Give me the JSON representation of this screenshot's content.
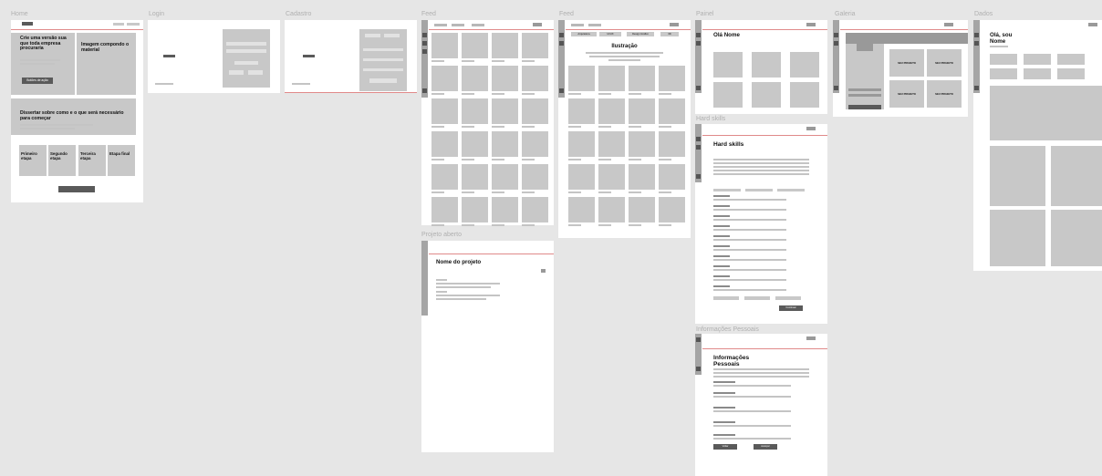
{
  "frames": {
    "home": "Home",
    "login": "Login",
    "cadastro": "Cadastro",
    "feed1": "Feed",
    "feed2": "Feed",
    "painel": "Painel",
    "galeria": "Galeria",
    "dados": "Dados",
    "projeto": "Projeto aberto",
    "hard": "Hard skills",
    "info": "Informações Pessoais"
  },
  "home": {
    "hero_title": "Crie uma versão sua que toda empresa procuraria",
    "hero_button": "Botões de ação",
    "image_label": "Imagem compondo o material",
    "section_title": "Dissertar sobre como e o que será necessário para começar",
    "steps": [
      "Primeiro etapa",
      "Segundo etapa",
      "Terceira etapa",
      "Etapa final"
    ]
  },
  "feed": {
    "title": "Ilustração",
    "filters": [
      "Arquitetura",
      "UI/UX",
      "Design Gráfico",
      "3D"
    ]
  },
  "painel": {
    "greeting": "Olá Nome"
  },
  "galeria": {
    "card": "SEU PROJETO"
  },
  "dados": {
    "greeting": "Olá, sou Nome"
  },
  "projeto": {
    "title": "Nome do projeto"
  },
  "hard": {
    "title": "Hard skills",
    "save": "Continuar"
  },
  "info": {
    "title": "Informações Pessoais",
    "back": "Voltar",
    "next": "Avançar"
  },
  "colors": {
    "canvas": "#e6e6e6",
    "accent_line": "#e08a8a",
    "placeholder": "#c8c8c8",
    "dark": "#5a5a5a"
  }
}
